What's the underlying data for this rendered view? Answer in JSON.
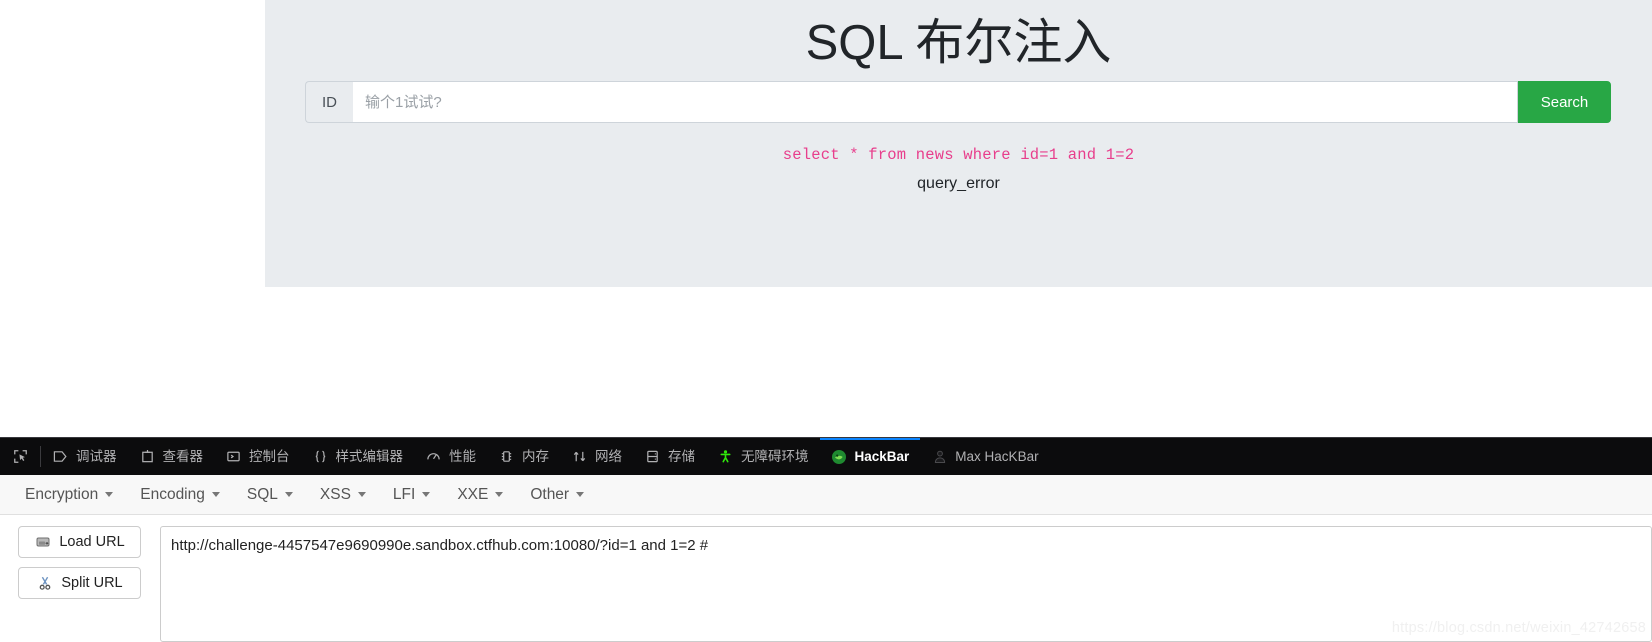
{
  "page": {
    "title": "SQL 布尔注入",
    "id_label": "ID",
    "input_value": "",
    "input_placeholder": "输个1试试?",
    "search_label": "Search",
    "sql_query": "select * from news where id=1 and 1=2",
    "result_text": "query_error",
    "sql_color": "#e83e8c",
    "accent_color": "#28a745",
    "panel_bg": "#e9ecef"
  },
  "devtools": {
    "picker_icon": "element-picker-icon",
    "tabs": [
      {
        "label": "调试器",
        "icon": "debugger-icon",
        "active": false
      },
      {
        "label": "查看器",
        "icon": "inspector-icon",
        "active": false
      },
      {
        "label": "控制台",
        "icon": "console-icon",
        "active": false
      },
      {
        "label": "样式编辑器",
        "icon": "style-editor-icon",
        "active": false
      },
      {
        "label": "性能",
        "icon": "performance-icon",
        "active": false
      },
      {
        "label": "内存",
        "icon": "memory-icon",
        "active": false
      },
      {
        "label": "网络",
        "icon": "network-icon",
        "active": false
      },
      {
        "label": "存储",
        "icon": "storage-icon",
        "active": false
      },
      {
        "label": "无障碍环境",
        "icon": "accessibility-icon",
        "active": false
      },
      {
        "label": "HackBar",
        "icon": "hackbar-icon",
        "active": true
      },
      {
        "label": "Max HacKBar",
        "icon": "max-hackbar-icon",
        "active": false
      }
    ],
    "active_tab_underline_color": "#0a84ff"
  },
  "hackbar": {
    "menus": [
      {
        "label": "Encryption"
      },
      {
        "label": "Encoding"
      },
      {
        "label": "SQL"
      },
      {
        "label": "XSS"
      },
      {
        "label": "LFI"
      },
      {
        "label": "XXE"
      },
      {
        "label": "Other"
      }
    ],
    "buttons": [
      {
        "label": "Load URL",
        "icon": "load-url-icon"
      },
      {
        "label": "Split URL",
        "icon": "split-url-icon"
      }
    ],
    "url_value": "http://challenge-4457547e9690990e.sandbox.ctfhub.com:10080/?id=1 and 1=2 #"
  },
  "watermark": {
    "text": "https://blog.csdn.net/weixin_42742658"
  }
}
